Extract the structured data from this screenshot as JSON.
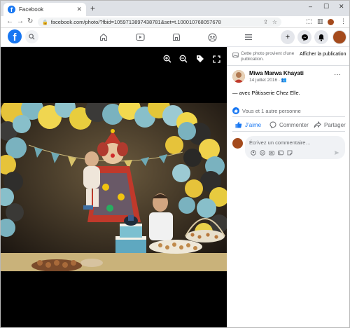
{
  "browser": {
    "tab_title": "Facebook",
    "url": "facebook.com/photo/?fbid=1059713897438781&set=t.100010768057678",
    "window_controls": {
      "minimize": "–",
      "maximize": "☐",
      "close": "✕"
    }
  },
  "facebook_nav": {
    "logo_letter": "f",
    "icons": [
      "search-icon",
      "home-icon",
      "watch-icon",
      "marketplace-icon",
      "groups-icon",
      "menu-icon",
      "create-icon",
      "messenger-icon",
      "notifications-icon"
    ]
  },
  "viewer": {
    "controls": [
      "zoom-in-icon",
      "zoom-out-icon",
      "tag-icon",
      "fullscreen-icon"
    ]
  },
  "side_panel": {
    "hint_text": "Cette photo provient d’une publication.",
    "show_post_link": "Afficher la publication",
    "poster_name": "Miwa Marwa Khayati",
    "post_date": "14 juillet 2016 · ",
    "caption_prefix": "— avec ",
    "caption_tag": "Pâtisserie Chez Elle",
    "caption_suffix": ".",
    "reactions_text": "Vous et 1 autre personne",
    "actions": {
      "like": "J’aime",
      "comment": "Commenter",
      "share": "Partager"
    },
    "comment_placeholder": "Écrivez un commentaire…"
  },
  "colors": {
    "brand": "#1877f2",
    "muted_text": "#65676b"
  }
}
